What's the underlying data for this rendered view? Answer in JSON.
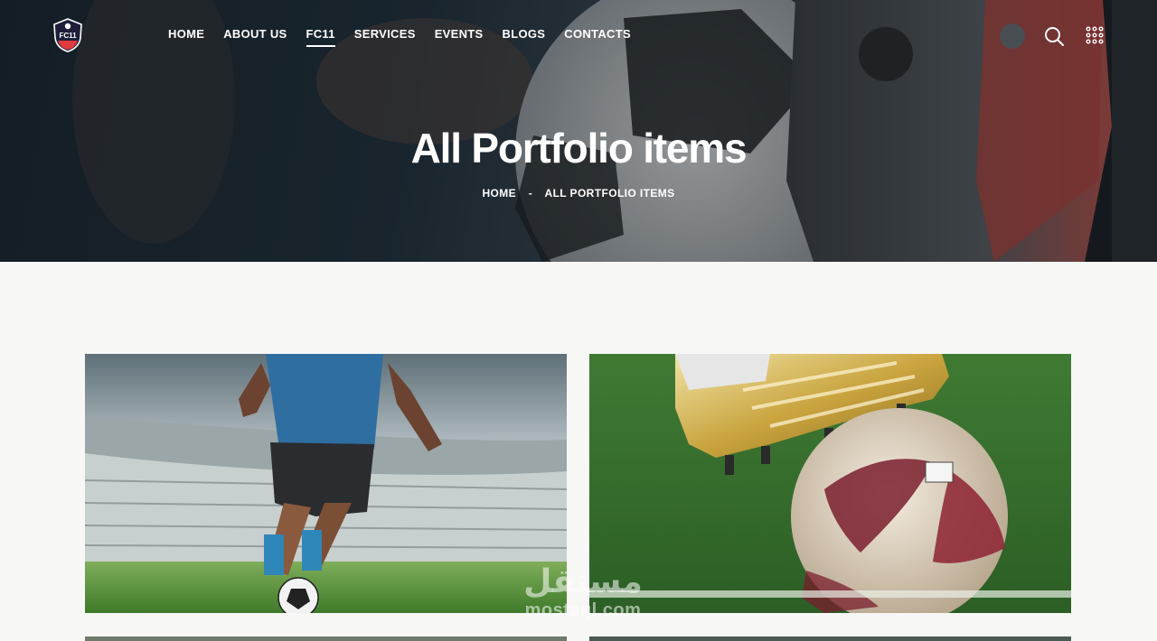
{
  "nav": {
    "logo_text": "FC11",
    "items": [
      {
        "label": "HOME"
      },
      {
        "label": "ABOUT US"
      },
      {
        "label": "FC11",
        "active": true
      },
      {
        "label": "SERVICES"
      },
      {
        "label": "EVENTS"
      },
      {
        "label": "BLOGS"
      },
      {
        "label": "CONTACTS"
      }
    ],
    "search_icon": "search-icon",
    "menu_icon": "grid-menu-icon"
  },
  "hero": {
    "title": "All Portfolio items",
    "breadcrumb": {
      "home": "HOME",
      "separator": "-",
      "current": "ALL PORTFOLIO ITEMS"
    }
  },
  "watermark": {
    "arabic": "مستقل",
    "latin": "mostaql.com"
  },
  "colors": {
    "hero_bg": "#1b2631",
    "page_bg": "#f7f7f5",
    "accent": "#e03a3e",
    "text_light": "#ffffff"
  }
}
